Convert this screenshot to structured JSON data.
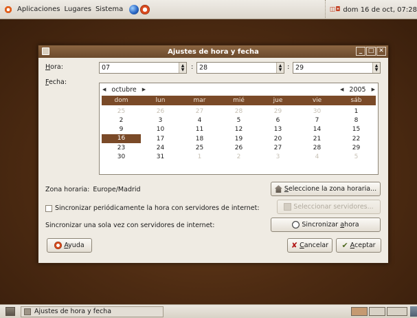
{
  "top_panel": {
    "menus": [
      "Aplicaciones",
      "Lugares",
      "Sistema"
    ],
    "clock": "dom 16 de oct, 07:28"
  },
  "dialog": {
    "title": "Ajustes de hora y fecha",
    "hora_label_u": "H",
    "hora_label_rest": "ora:",
    "hour": "07",
    "minute": "28",
    "second": "29",
    "fecha_label_u": "F",
    "fecha_label_rest": "echa:",
    "calendar": {
      "month": "octubre",
      "year": "2005",
      "weekdays": [
        "dom",
        "lun",
        "mar",
        "mié",
        "jue",
        "vie",
        "sáb"
      ],
      "weeks": [
        [
          "25",
          "26",
          "27",
          "28",
          "29",
          "30",
          "1"
        ],
        [
          "2",
          "3",
          "4",
          "5",
          "6",
          "7",
          "8"
        ],
        [
          "9",
          "10",
          "11",
          "12",
          "13",
          "14",
          "15"
        ],
        [
          "16",
          "17",
          "18",
          "19",
          "20",
          "21",
          "22"
        ],
        [
          "23",
          "24",
          "25",
          "26",
          "27",
          "28",
          "29"
        ],
        [
          "30",
          "31",
          "1",
          "2",
          "3",
          "4",
          "5"
        ]
      ],
      "selected_day": "16"
    },
    "timezone_label": "Zona horaria:",
    "timezone_value": "Europe/Madrid",
    "select_timezone_u": "S",
    "select_timezone_rest": "eleccione la zona horaria...",
    "sync_periodic_label": "Sincronizar periódicamente la hora con servidores de internet:",
    "sync_periodic_checked": false,
    "select_servers_button": "Seleccionar servidores...",
    "sync_once_label": "Sincronizar una sola vez con servidores de internet:",
    "sync_now_button_pre": "Sincronizar ",
    "sync_now_button_u": "a",
    "sync_now_button_post": "hora",
    "help_u": "A",
    "help_rest": "yuda",
    "cancel_u": "C",
    "cancel_rest": "ancelar",
    "accept_u": "A",
    "accept_rest": "ceptar"
  },
  "bottom_panel": {
    "task_title": "Ajustes de hora y fecha"
  },
  "colors": {
    "accent": "#7a4a28",
    "titlebar": "#7a5734",
    "desktop": "#5a3418"
  }
}
